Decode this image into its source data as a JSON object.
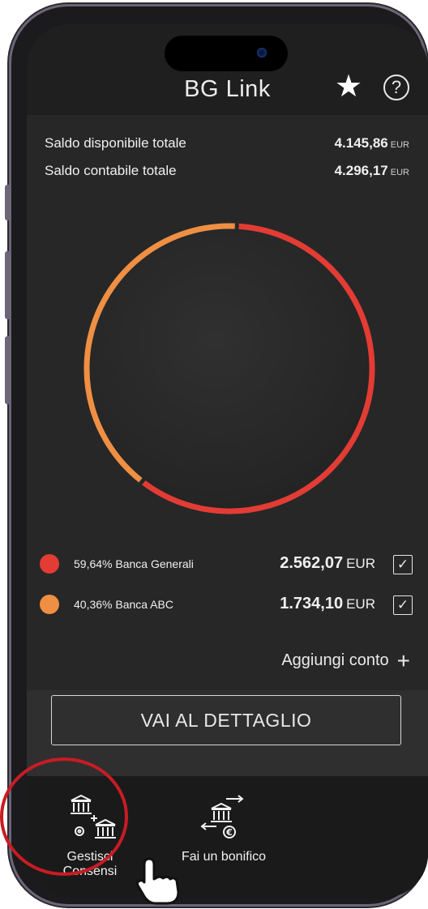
{
  "app": {
    "title": "BG Link"
  },
  "header": {
    "star_icon": "star-icon",
    "help_icon": "help-icon"
  },
  "balances": {
    "available": {
      "label": "Saldo disponibile totale",
      "value": "4.145,86",
      "currency": "EUR"
    },
    "accounting": {
      "label": "Saldo contabile totale",
      "value": "4.296,17",
      "currency": "EUR"
    }
  },
  "chart_data": {
    "type": "pie",
    "style": "donut",
    "series": [
      {
        "name": "Banca Generali",
        "percent": 59.64,
        "value": 2562.07,
        "color": "#e23c34"
      },
      {
        "name": "Banca ABC",
        "percent": 40.36,
        "value": 1734.1,
        "color": "#ee8f43"
      }
    ]
  },
  "accounts": [
    {
      "label": "59,64% Banca Generali",
      "amount": "2.562,07",
      "currency": "EUR",
      "color": "#e23c34",
      "checked": true
    },
    {
      "label": "40,36% Banca ABC",
      "amount": "1.734,10",
      "currency": "EUR",
      "color": "#ee8f43",
      "checked": true
    }
  ],
  "add_account": {
    "label": "Aggiungi conto",
    "icon": "plus-icon"
  },
  "cta": {
    "label": "VAI AL DETTAGLIO"
  },
  "bottom_actions": [
    {
      "line1": "Gestisci",
      "line2": "Consensi",
      "icon": "bank-consent-icon"
    },
    {
      "line1": "Fai un bonifico",
      "icon": "bank-transfer-icon"
    }
  ],
  "check_glyph": "✓"
}
